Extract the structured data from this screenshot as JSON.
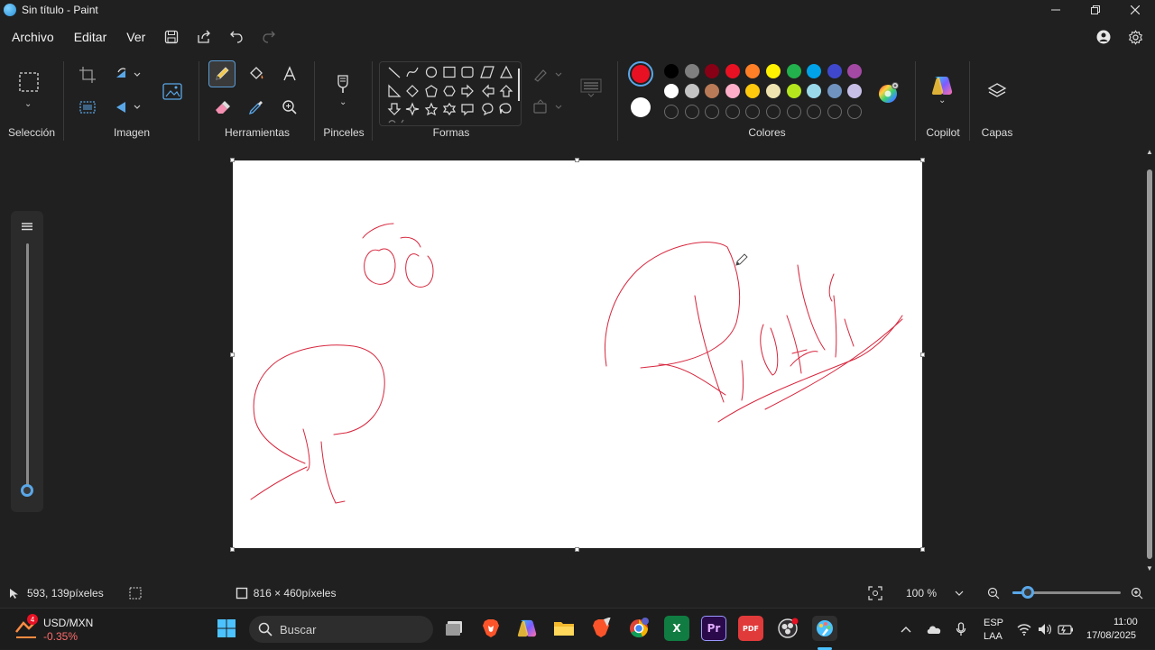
{
  "window": {
    "title": "Sin título - Paint"
  },
  "menu": {
    "items": [
      "Archivo",
      "Editar",
      "Ver"
    ]
  },
  "ribbon": {
    "groups": {
      "seleccion": "Selección",
      "imagen": "Imagen",
      "herramientas": "Herramientas",
      "pinceles": "Pinceles",
      "formas": "Formas",
      "colores": "Colores",
      "copilot": "Copilot",
      "capas": "Capas"
    },
    "active_tool": "pencil",
    "primary_color": "#e81123",
    "secondary_color": "#ffffff",
    "palette_row1": [
      "#000000",
      "#7f7f7f",
      "#880015",
      "#e81123",
      "#ff7f27",
      "#fff200",
      "#22b14c",
      "#00a2e8",
      "#3f48cc",
      "#a349a4"
    ],
    "palette_row2": [
      "#ffffff",
      "#c3c3c3",
      "#b97a57",
      "#ffaec9",
      "#ffc90e",
      "#efe4b0",
      "#b5e61d",
      "#99d9ea",
      "#7092be",
      "#c8bfe7"
    ],
    "palette_empty_count": 10
  },
  "canvas": {
    "stroke_color": "#d7263d"
  },
  "status": {
    "cursor_position": "593, 139píxeles",
    "canvas_size": "816 × 460píxeles",
    "zoom": "100 %",
    "zoom_slider_fraction": 0.14
  },
  "brush_slider": {
    "fraction": 0.0
  },
  "taskbar": {
    "widget_title": "USD/MXN",
    "widget_value": "-0.35%",
    "widget_badge": "4",
    "search_placeholder": "Buscar",
    "lang_top": "ESP",
    "lang_bottom": "LAA",
    "time": "11:00",
    "date": "17/08/2025"
  }
}
